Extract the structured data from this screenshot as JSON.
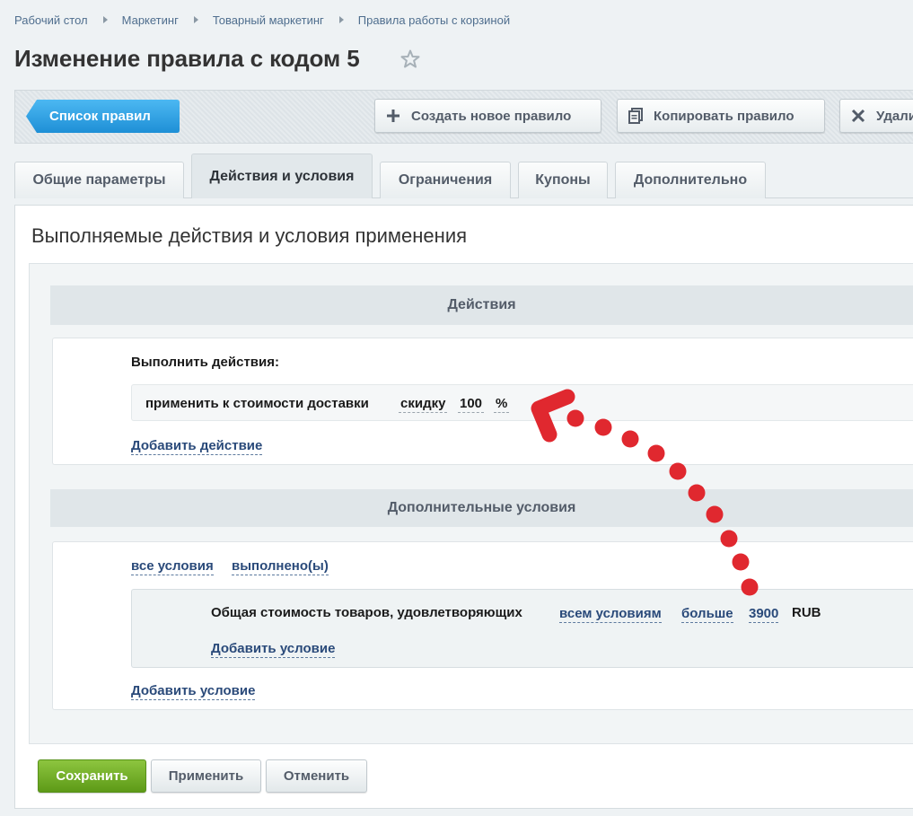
{
  "breadcrumb": [
    "Рабочий стол",
    "Маркетинг",
    "Товарный маркетинг",
    "Правила работы с корзиной"
  ],
  "page_title": "Изменение правила с кодом 5",
  "toolbar": {
    "list_label": "Список правил",
    "create_label": "Создать новое правило",
    "copy_label": "Копировать правило",
    "delete_label": "Удалить"
  },
  "tabs": [
    "Общие параметры",
    "Действия и условия",
    "Ограничения",
    "Купоны",
    "Дополнительно"
  ],
  "active_tab": "Действия и условия",
  "section_title": "Выполняемые действия и условия применения",
  "actions": {
    "header": "Действия",
    "label": "Выполнить действия:",
    "row_text": "применить к стоимости доставки",
    "discount_type": "скидку",
    "value": "100",
    "unit": "%",
    "add_action": "Добавить действие"
  },
  "conditions": {
    "header": "Дополнительные условия",
    "all_conditions": "все условия",
    "fulfilled": "выполнено(ы)",
    "condition_text": "Общая стоимость товаров, удовлетворяющих",
    "condition_scope": "всем условиям",
    "comparison": "больше",
    "value": "3900",
    "currency": "RUB",
    "add_condition_inner": "Добавить условие",
    "add_condition_outer": "Добавить условие"
  },
  "footer": {
    "save": "Сохранить",
    "apply": "Применить",
    "cancel": "Отменить"
  },
  "colors": {
    "accent_blue": "#2fa4e7",
    "save_green": "#6ea92a",
    "annotation_red": "#e0282f",
    "link_blue": "#2a4a7a"
  },
  "icons": [
    "star-icon",
    "plus-icon",
    "copy-icon",
    "close-icon"
  ]
}
